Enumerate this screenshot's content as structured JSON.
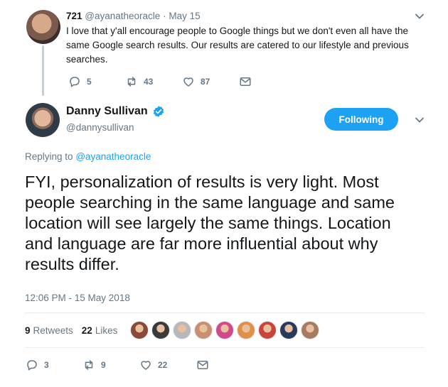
{
  "parent_tweet": {
    "name": "721",
    "handle": "@ayanatheoracle",
    "separator": "·",
    "date": "May 15",
    "text": "I love that y'all encourage people to Google things but we don't even all have the same Google search results. Our results are catered to our lifestyle and previous searches.",
    "replies": "5",
    "retweets": "43",
    "likes": "87"
  },
  "main_tweet": {
    "name": "Danny Sullivan",
    "handle": "@dannysullivan",
    "follow_button": "Following",
    "replying_to_prefix": "Replying to",
    "replying_to_handle": "@ayanatheoracle",
    "text": "FYI, personalization of results is very light. Most people searching in the same language and same location will see largely the same things. Location and language are far more influential about why results differ.",
    "timestamp": "12:06 PM - 15 May 2018",
    "retweet_count": "9",
    "retweet_label": "Retweets",
    "like_count": "22",
    "like_label": "Likes",
    "likers": [
      {
        "color": "#8a4a3a"
      },
      {
        "color": "#3a3a3a"
      },
      {
        "color": "#b8b8b8"
      },
      {
        "color": "#c89070"
      },
      {
        "color": "#d14a8a"
      },
      {
        "color": "#e0904a"
      },
      {
        "color": "#c8453a"
      },
      {
        "color": "#2a3a5a"
      },
      {
        "color": "#a87a60"
      }
    ],
    "replies": "3",
    "retweets": "9",
    "likes": "22"
  },
  "colors": {
    "accent": "#1da1f2",
    "text": "#14171a",
    "muted": "#657786",
    "divider": "#e6ecf0",
    "thread_line": "#c4cfd6"
  }
}
